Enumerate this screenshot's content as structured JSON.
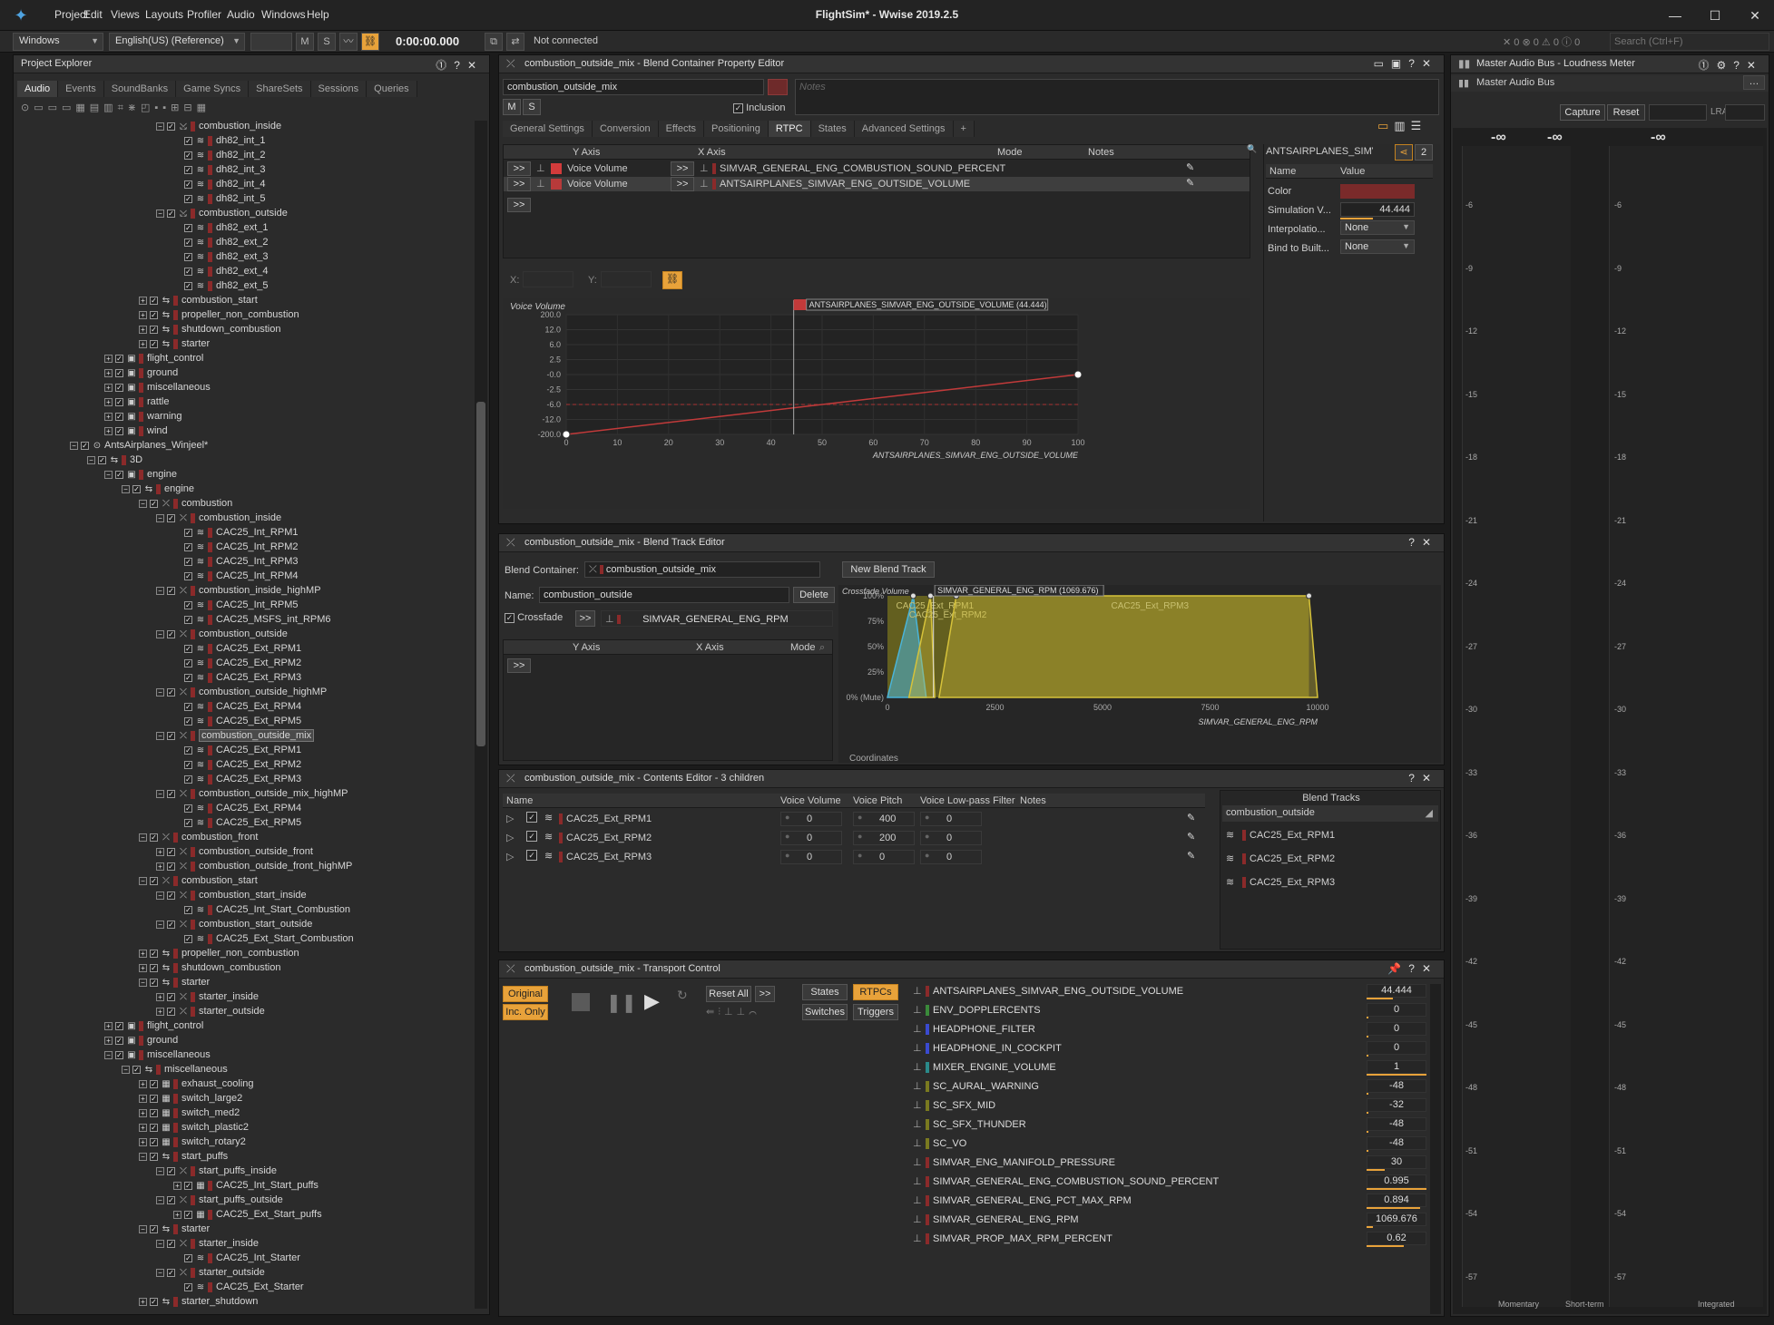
{
  "app": {
    "title": "FlightSim* - Wwise 2019.2.5",
    "menu": [
      "Project",
      "Edit",
      "Views",
      "Layouts",
      "Profiler",
      "Audio",
      "Windows",
      "Help"
    ]
  },
  "toolbar": {
    "platform": "Windows",
    "language": "English(US) (Reference)",
    "m": "M",
    "s": "S",
    "time": "0:00:00.000",
    "connection": "Not connected",
    "search_placeholder": "Search (Ctrl+F)",
    "counts": [
      "0",
      "0",
      "0",
      "0"
    ]
  },
  "explorer": {
    "title": "Project Explorer",
    "tabs": [
      "Audio",
      "Events",
      "SoundBanks",
      "Game Syncs",
      "ShareSets",
      "Sessions",
      "Queries"
    ],
    "rows": [
      {
        "i": 3,
        "t": "rnd",
        "l": "combustion_inside",
        "e": "-"
      },
      {
        "i": 4,
        "t": "snd",
        "l": "dh82_int_1"
      },
      {
        "i": 4,
        "t": "snd",
        "l": "dh82_int_2"
      },
      {
        "i": 4,
        "t": "snd",
        "l": "dh82_int_3"
      },
      {
        "i": 4,
        "t": "snd",
        "l": "dh82_int_4"
      },
      {
        "i": 4,
        "t": "snd",
        "l": "dh82_int_5"
      },
      {
        "i": 3,
        "t": "rnd",
        "l": "combustion_outside",
        "e": "-"
      },
      {
        "i": 4,
        "t": "snd",
        "l": "dh82_ext_1"
      },
      {
        "i": 4,
        "t": "snd",
        "l": "dh82_ext_2"
      },
      {
        "i": 4,
        "t": "snd",
        "l": "dh82_ext_3"
      },
      {
        "i": 4,
        "t": "snd",
        "l": "dh82_ext_4"
      },
      {
        "i": 4,
        "t": "snd",
        "l": "dh82_ext_5"
      },
      {
        "i": 2,
        "t": "swc",
        "l": "combustion_start",
        "e": "+"
      },
      {
        "i": 2,
        "t": "swc",
        "l": "propeller_non_combustion",
        "e": "+"
      },
      {
        "i": 2,
        "t": "swc",
        "l": "shutdown_combustion",
        "e": "+"
      },
      {
        "i": 2,
        "t": "swc",
        "l": "starter",
        "e": "+"
      },
      {
        "i": 0,
        "t": "fld",
        "l": "flight_control",
        "e": "+"
      },
      {
        "i": 0,
        "t": "fld",
        "l": "ground",
        "e": "+"
      },
      {
        "i": 0,
        "t": "fld",
        "l": "miscellaneous",
        "e": "+"
      },
      {
        "i": 0,
        "t": "fld",
        "l": "rattle",
        "e": "+"
      },
      {
        "i": 0,
        "t": "fld",
        "l": "warning",
        "e": "+"
      },
      {
        "i": 0,
        "t": "fld",
        "l": "wind",
        "e": "+"
      },
      {
        "i": -2,
        "t": "wu",
        "l": "AntsAirplanes_Winjeel*",
        "e": "-"
      },
      {
        "i": -1,
        "t": "swc",
        "l": "3D",
        "e": "-"
      },
      {
        "i": 0,
        "t": "fld",
        "l": "engine",
        "e": "-"
      },
      {
        "i": 1,
        "t": "swc",
        "l": "engine",
        "e": "-"
      },
      {
        "i": 2,
        "t": "blend",
        "l": "combustion",
        "e": "-"
      },
      {
        "i": 3,
        "t": "blend",
        "l": "combustion_inside",
        "e": "-"
      },
      {
        "i": 4,
        "t": "snd",
        "l": "CAC25_Int_RPM1"
      },
      {
        "i": 4,
        "t": "snd",
        "l": "CAC25_Int_RPM2"
      },
      {
        "i": 4,
        "t": "snd",
        "l": "CAC25_Int_RPM3"
      },
      {
        "i": 4,
        "t": "snd",
        "l": "CAC25_Int_RPM4"
      },
      {
        "i": 3,
        "t": "blend",
        "l": "combustion_inside_highMP",
        "e": "-"
      },
      {
        "i": 4,
        "t": "snd",
        "l": "CAC25_Int_RPM5"
      },
      {
        "i": 4,
        "t": "snd",
        "l": "CAC25_MSFS_int_RPM6"
      },
      {
        "i": 3,
        "t": "blend",
        "l": "combustion_outside",
        "e": "-"
      },
      {
        "i": 4,
        "t": "snd",
        "l": "CAC25_Ext_RPM1"
      },
      {
        "i": 4,
        "t": "snd",
        "l": "CAC25_Ext_RPM2"
      },
      {
        "i": 4,
        "t": "snd",
        "l": "CAC25_Ext_RPM3"
      },
      {
        "i": 3,
        "t": "blend",
        "l": "combustion_outside_highMP",
        "e": "-"
      },
      {
        "i": 4,
        "t": "snd",
        "l": "CAC25_Ext_RPM4"
      },
      {
        "i": 4,
        "t": "snd",
        "l": "CAC25_Ext_RPM5"
      },
      {
        "i": 3,
        "t": "blend",
        "l": "combustion_outside_mix",
        "e": "-",
        "sel": true
      },
      {
        "i": 4,
        "t": "snd",
        "l": "CAC25_Ext_RPM1"
      },
      {
        "i": 4,
        "t": "snd",
        "l": "CAC25_Ext_RPM2"
      },
      {
        "i": 4,
        "t": "snd",
        "l": "CAC25_Ext_RPM3"
      },
      {
        "i": 3,
        "t": "blend",
        "l": "combustion_outside_mix_highMP",
        "e": "-"
      },
      {
        "i": 4,
        "t": "snd",
        "l": "CAC25_Ext_RPM4"
      },
      {
        "i": 4,
        "t": "snd",
        "l": "CAC25_Ext_RPM5"
      },
      {
        "i": 2,
        "t": "blend",
        "l": "combustion_front",
        "e": "-"
      },
      {
        "i": 3,
        "t": "blend",
        "l": "combustion_outside_front",
        "e": "+"
      },
      {
        "i": 3,
        "t": "blend",
        "l": "combustion_outside_front_highMP",
        "e": "+"
      },
      {
        "i": 2,
        "t": "blend",
        "l": "combustion_start",
        "e": "-"
      },
      {
        "i": 3,
        "t": "blend",
        "l": "combustion_start_inside",
        "e": "-"
      },
      {
        "i": 4,
        "t": "snd",
        "l": "CAC25_Int_Start_Combustion"
      },
      {
        "i": 3,
        "t": "blend",
        "l": "combustion_start_outside",
        "e": "-"
      },
      {
        "i": 4,
        "t": "snd",
        "l": "CAC25_Ext_Start_Combustion"
      },
      {
        "i": 2,
        "t": "swc",
        "l": "propeller_non_combustion",
        "e": "+"
      },
      {
        "i": 2,
        "t": "swc",
        "l": "shutdown_combustion",
        "e": "+"
      },
      {
        "i": 2,
        "t": "swc",
        "l": "starter",
        "e": "-"
      },
      {
        "i": 3,
        "t": "blend",
        "l": "starter_inside",
        "e": "+"
      },
      {
        "i": 3,
        "t": "blend",
        "l": "starter_outside",
        "e": "+"
      },
      {
        "i": 0,
        "t": "fld",
        "l": "flight_control",
        "e": "+"
      },
      {
        "i": 0,
        "t": "fld",
        "l": "ground",
        "e": "+"
      },
      {
        "i": 0,
        "t": "fld",
        "l": "miscellaneous",
        "e": "-"
      },
      {
        "i": 1,
        "t": "swc",
        "l": "miscellaneous",
        "e": "-"
      },
      {
        "i": 2,
        "t": "seq",
        "l": "exhaust_cooling",
        "e": "+"
      },
      {
        "i": 2,
        "t": "seq",
        "l": "switch_large2",
        "e": "+"
      },
      {
        "i": 2,
        "t": "seq",
        "l": "switch_med2",
        "e": "+"
      },
      {
        "i": 2,
        "t": "seq",
        "l": "switch_plastic2",
        "e": "+"
      },
      {
        "i": 2,
        "t": "seq",
        "l": "switch_rotary2",
        "e": "+"
      },
      {
        "i": 2,
        "t": "swc",
        "l": "start_puffs",
        "e": "-"
      },
      {
        "i": 3,
        "t": "blend",
        "l": "start_puffs_inside",
        "e": "-"
      },
      {
        "i": 4,
        "t": "seq",
        "l": "CAC25_Int_Start_puffs",
        "e": "+"
      },
      {
        "i": 3,
        "t": "blend",
        "l": "start_puffs_outside",
        "e": "-"
      },
      {
        "i": 4,
        "t": "seq",
        "l": "CAC25_Ext_Start_puffs",
        "e": "+"
      },
      {
        "i": 2,
        "t": "swc",
        "l": "starter",
        "e": "-"
      },
      {
        "i": 3,
        "t": "blend",
        "l": "starter_inside",
        "e": "-"
      },
      {
        "i": 4,
        "t": "snd",
        "l": "CAC25_Int_Starter"
      },
      {
        "i": 3,
        "t": "blend",
        "l": "starter_outside",
        "e": "-"
      },
      {
        "i": 4,
        "t": "snd",
        "l": "CAC25_Ext_Starter"
      },
      {
        "i": 2,
        "t": "swc",
        "l": "starter_shutdown",
        "e": "+"
      }
    ]
  },
  "prop_editor": {
    "title": "combustion_outside_mix - Blend Container Property Editor",
    "name": "combustion_outside_mix",
    "notes_placeholder": "Notes",
    "m": "M",
    "s": "S",
    "inclusion": "Inclusion",
    "tabs": [
      "General Settings",
      "Conversion",
      "Effects",
      "Positioning",
      "RTPC",
      "States",
      "Advanced Settings",
      "+"
    ],
    "rtpc_headers": {
      "y": "Y Axis",
      "x": "X Axis",
      "mode": "Mode",
      "notes": "Notes"
    },
    "rtpc_rows": [
      {
        "btn": ">>",
        "y": "Voice Volume",
        "x": "SIMVAR_GENERAL_ENG_COMBUSTION_SOUND_PERCENT",
        "color": "#d23b3b"
      },
      {
        "btn": ">>",
        "y": "Voice Volume",
        "x": "ANTSAIRPLANES_SIMVAR_ENG_OUTSIDE_VOLUME",
        "color": "#b83a3a"
      }
    ],
    "xy": {
      "x": "X:",
      "y": "Y:"
    },
    "side": {
      "title": "ANTSAIRPLANES_SIMV.",
      "count": "2",
      "hdr_name": "Name",
      "hdr_value": "Value",
      "rows": [
        {
          "n": "Color",
          "v": ""
        },
        {
          "n": "Simulation V...",
          "v": "44.444"
        },
        {
          "n": "Interpolatio...",
          "v": "None"
        },
        {
          "n": "Bind to Built...",
          "v": "None"
        }
      ]
    }
  },
  "chart_data": [
    {
      "type": "line",
      "title": "",
      "ylabel": "Voice Volume",
      "xlabel": "ANTSAIRPLANES_SIMVAR_ENG_OUTSIDE_VOLUME",
      "cursor_label": "ANTSAIRPLANES_SIMVAR_ENG_OUTSIDE_VOLUME (44.444)",
      "cursor_x": 44.444,
      "xticks": [
        "0",
        "10",
        "20",
        "30",
        "40",
        "50",
        "60",
        "70",
        "80",
        "90",
        "100"
      ],
      "yticks": [
        "200.0",
        "12.0",
        "6.0",
        "2.5",
        "-0.0",
        "-2.5",
        "-6.0",
        "-12.0",
        "-200.0"
      ],
      "series": [
        {
          "x": [
            0,
            100
          ],
          "y": [
            -200.0,
            0.0
          ]
        }
      ],
      "xlim": [
        0,
        100
      ]
    },
    {
      "type": "area",
      "title": "",
      "ylabel": "Crossfade Volume",
      "xlabel": "SIMVAR_GENERAL_ENG_RPM",
      "cursor_label": "SIMVAR_GENERAL_ENG_RPM (1069.676)",
      "cursor_x": 1069.676,
      "yticks": [
        "100%",
        "75%",
        "50%",
        "25%",
        "0% (Mute)"
      ],
      "xticks": [
        "0",
        "2500",
        "5000",
        "7500",
        "10000"
      ],
      "xlim": [
        0,
        10000
      ],
      "series": [
        {
          "name": "CAC25_Ext_RPM1",
          "color": "#4ab4d8"
        },
        {
          "name": "CAC25_Ext_RPM2",
          "color": "#d6c23a"
        },
        {
          "name": "CAC25_Ext_RPM3",
          "color": "#d6c23a"
        }
      ]
    }
  ],
  "blend_track": {
    "title": "combustion_outside_mix - Blend Track Editor",
    "container_label": "Blend Container:",
    "container": "combustion_outside_mix",
    "new_btn": "New Blend Track",
    "name_label": "Name:",
    "name": "combustion_outside",
    "delete": "Delete",
    "crossfade": "Crossfade",
    "crossfade_param": "SIMVAR_GENERAL_ENG_RPM",
    "hdr_y": "Y Axis",
    "hdr_x": "X Axis",
    "hdr_mode": "Mode",
    "coords": "Coordinates",
    "btn": ">>"
  },
  "contents": {
    "title": "combustion_outside_mix - Contents Editor - 3 children",
    "headers": [
      "Name",
      "Voice Volume",
      "Voice Pitch",
      "Voice Low-pass Filter",
      "Notes"
    ],
    "rows": [
      {
        "name": "CAC25_Ext_RPM1",
        "vol": "0",
        "pitch": "400",
        "lpf": "0"
      },
      {
        "name": "CAC25_Ext_RPM2",
        "vol": "0",
        "pitch": "200",
        "lpf": "0"
      },
      {
        "name": "CAC25_Ext_RPM3",
        "vol": "0",
        "pitch": "0",
        "lpf": "0"
      }
    ],
    "blend_tracks_title": "Blend Tracks",
    "blend_track": "combustion_outside",
    "children": [
      "CAC25_Ext_RPM1",
      "CAC25_Ext_RPM2",
      "CAC25_Ext_RPM3"
    ]
  },
  "transport": {
    "title": "combustion_outside_mix - Transport Control",
    "original": "Original",
    "inc_only": "Inc. Only",
    "reset_all": "Reset All",
    "btn": ">>",
    "states": "States",
    "rtpcs": "RTPCs",
    "switches": "Switches",
    "triggers": "Triggers",
    "rtpcs_list": [
      {
        "n": "ANTSAIRPLANES_SIMVAR_ENG_OUTSIDE_VOLUME",
        "v": "44.444",
        "c": "#8b2a2a",
        "f": 0.44
      },
      {
        "n": "ENV_DOPPLERCENTS",
        "v": "0",
        "c": "#3a8a3a",
        "f": 0
      },
      {
        "n": "HEADPHONE_FILTER",
        "v": "0",
        "c": "#3a4ad0",
        "f": 0
      },
      {
        "n": "HEADPHONE_IN_COCKPIT",
        "v": "0",
        "c": "#3a4ad0",
        "f": 0
      },
      {
        "n": "MIXER_ENGINE_VOLUME",
        "v": "1",
        "c": "#2a8a8a",
        "f": 1
      },
      {
        "n": "SC_AURAL_WARNING",
        "v": "-48",
        "c": "#7a7a20",
        "f": 0
      },
      {
        "n": "SC_SFX_MID",
        "v": "-32",
        "c": "#7a7a20",
        "f": 0
      },
      {
        "n": "SC_SFX_THUNDER",
        "v": "-48",
        "c": "#7a7a20",
        "f": 0
      },
      {
        "n": "SC_VO",
        "v": "-48",
        "c": "#7a7a20",
        "f": 0
      },
      {
        "n": "SIMVAR_ENG_MANIFOLD_PRESSURE",
        "v": "30",
        "c": "#8b2a2a",
        "f": 0.3
      },
      {
        "n": "SIMVAR_GENERAL_ENG_COMBUSTION_SOUND_PERCENT",
        "v": "0.995",
        "c": "#8b2a2a",
        "f": 0.995
      },
      {
        "n": "SIMVAR_GENERAL_ENG_PCT_MAX_RPM",
        "v": "0.894",
        "c": "#8b2a2a",
        "f": 0.894
      },
      {
        "n": "SIMVAR_GENERAL_ENG_RPM",
        "v": "1069.676",
        "c": "#8b2a2a",
        "f": 0.1
      },
      {
        "n": "SIMVAR_PROP_MAX_RPM_PERCENT",
        "v": "0.62",
        "c": "#8b2a2a",
        "f": 0.62
      }
    ]
  },
  "meter": {
    "title": "Master Audio Bus - Loudness Meter",
    "bus": "Master Audio Bus",
    "capture": "Capture",
    "reset": "Reset",
    "lra": "LRA",
    "inf": "-∞",
    "scale": [
      "-6",
      "-9",
      "-12",
      "-15",
      "-18",
      "-21",
      "-24",
      "-27",
      "-30",
      "-33",
      "-36",
      "-39",
      "-42",
      "-45",
      "-48",
      "-51",
      "-54",
      "-57"
    ],
    "momentary": "Momentary",
    "short_term": "Short-term",
    "integrated": "Integrated"
  }
}
